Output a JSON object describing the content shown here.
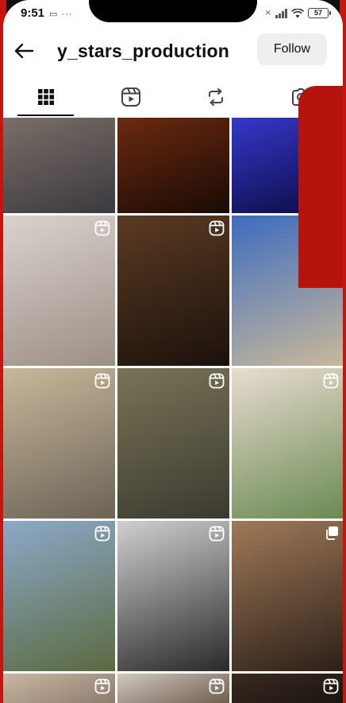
{
  "status_bar": {
    "time": "9:51",
    "left_icons": "▭ ···",
    "battery": "57"
  },
  "header": {
    "username": "y_stars_production",
    "follow_label": "Follow"
  },
  "tabs": [
    {
      "name": "grid-icon",
      "active": true
    },
    {
      "name": "reels-icon",
      "active": false
    },
    {
      "name": "reposts-icon",
      "active": false
    },
    {
      "name": "tagged-icon",
      "active": false
    }
  ],
  "grid": {
    "rows": [
      [
        {
          "subject": "woman on street at dusk",
          "colors": [
            "#7a6e68",
            "#3b3a3e"
          ],
          "badge": "none"
        },
        {
          "subject": "library with open book",
          "colors": [
            "#6b2a10",
            "#1a0a05"
          ],
          "badge": "none"
        },
        {
          "subject": "car headlight",
          "colors": [
            "#3538c9",
            "#0a0a40"
          ],
          "badge": "none"
        }
      ],
      [
        {
          "subject": "woman with pink suitcases at airport",
          "colors": [
            "#d9d2cc",
            "#9c8f86"
          ],
          "badge": "reel"
        },
        {
          "subject": "man in suit in dark room",
          "colors": [
            "#5b3b22",
            "#1b120c"
          ],
          "badge": "reel"
        },
        {
          "subject": "rooftop solar panels",
          "colors": [
            "#3d6cc0",
            "#c8b89a"
          ],
          "badge": "none"
        }
      ],
      [
        {
          "subject": "storefront sign",
          "colors": [
            "#c7b89a",
            "#6b6356"
          ],
          "badge": "reel"
        },
        {
          "subject": "aerial roundabout",
          "colors": [
            "#7a7456",
            "#3a3a30"
          ],
          "badge": "reel"
        },
        {
          "subject": "aerial house with red roof",
          "colors": [
            "#e8dcd0",
            "#6a8a52"
          ],
          "badge": "reel"
        }
      ],
      [
        {
          "subject": "group of cyclists outdoors",
          "colors": [
            "#8ba9c9",
            "#5b6a40"
          ],
          "badge": "reel"
        },
        {
          "subject": "black and white car close-up",
          "colors": [
            "#cfcfcf",
            "#2a2a2a"
          ],
          "badge": "reel"
        },
        {
          "subject": "film crew indoors",
          "colors": [
            "#a07a58",
            "#2c2018"
          ],
          "badge": "multi"
        }
      ],
      [
        {
          "subject": "partial",
          "colors": [
            "#c9b7a4",
            "#8a7a6a"
          ],
          "badge": "reel"
        },
        {
          "subject": "partial",
          "colors": [
            "#d0c8c0",
            "#6a5a4a"
          ],
          "badge": "reel"
        },
        {
          "subject": "partial",
          "colors": [
            "#3a2a20",
            "#1a1410"
          ],
          "badge": "reel"
        }
      ]
    ]
  },
  "accent": {
    "frame_red": "#c4160e"
  }
}
